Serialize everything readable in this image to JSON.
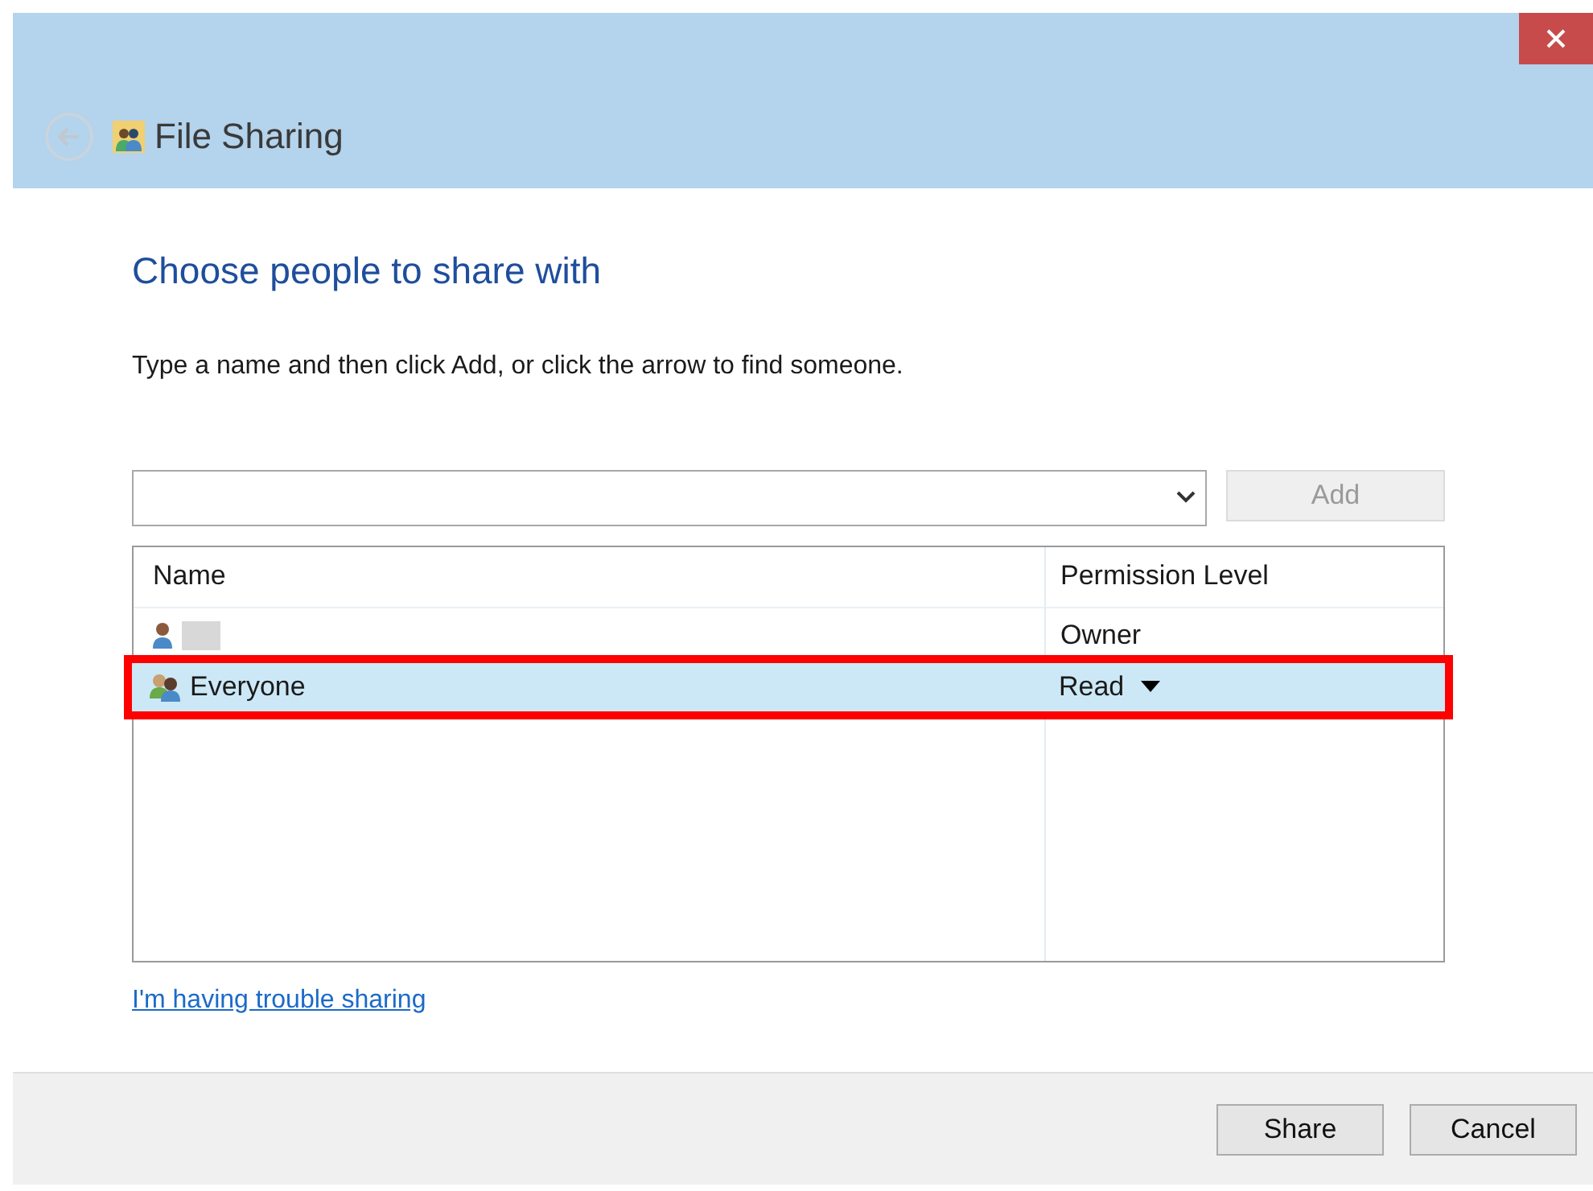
{
  "window": {
    "title": "File Sharing"
  },
  "heading": "Choose people to share with",
  "instruction": "Type a name and then click Add, or click the arrow to find someone.",
  "add_button": {
    "label": "Add",
    "disabled": true
  },
  "table": {
    "columns": [
      "Name",
      "Permission Level"
    ],
    "rows": [
      {
        "kind": "user",
        "name": "",
        "permission": "Owner",
        "has_dropdown": false,
        "selected": false,
        "highlighted": false
      },
      {
        "kind": "group",
        "name": "Everyone",
        "permission": "Read",
        "has_dropdown": true,
        "selected": true,
        "highlighted": true
      }
    ]
  },
  "help_link": "I'm having trouble sharing",
  "buttons": [
    "Share",
    "Cancel"
  ]
}
